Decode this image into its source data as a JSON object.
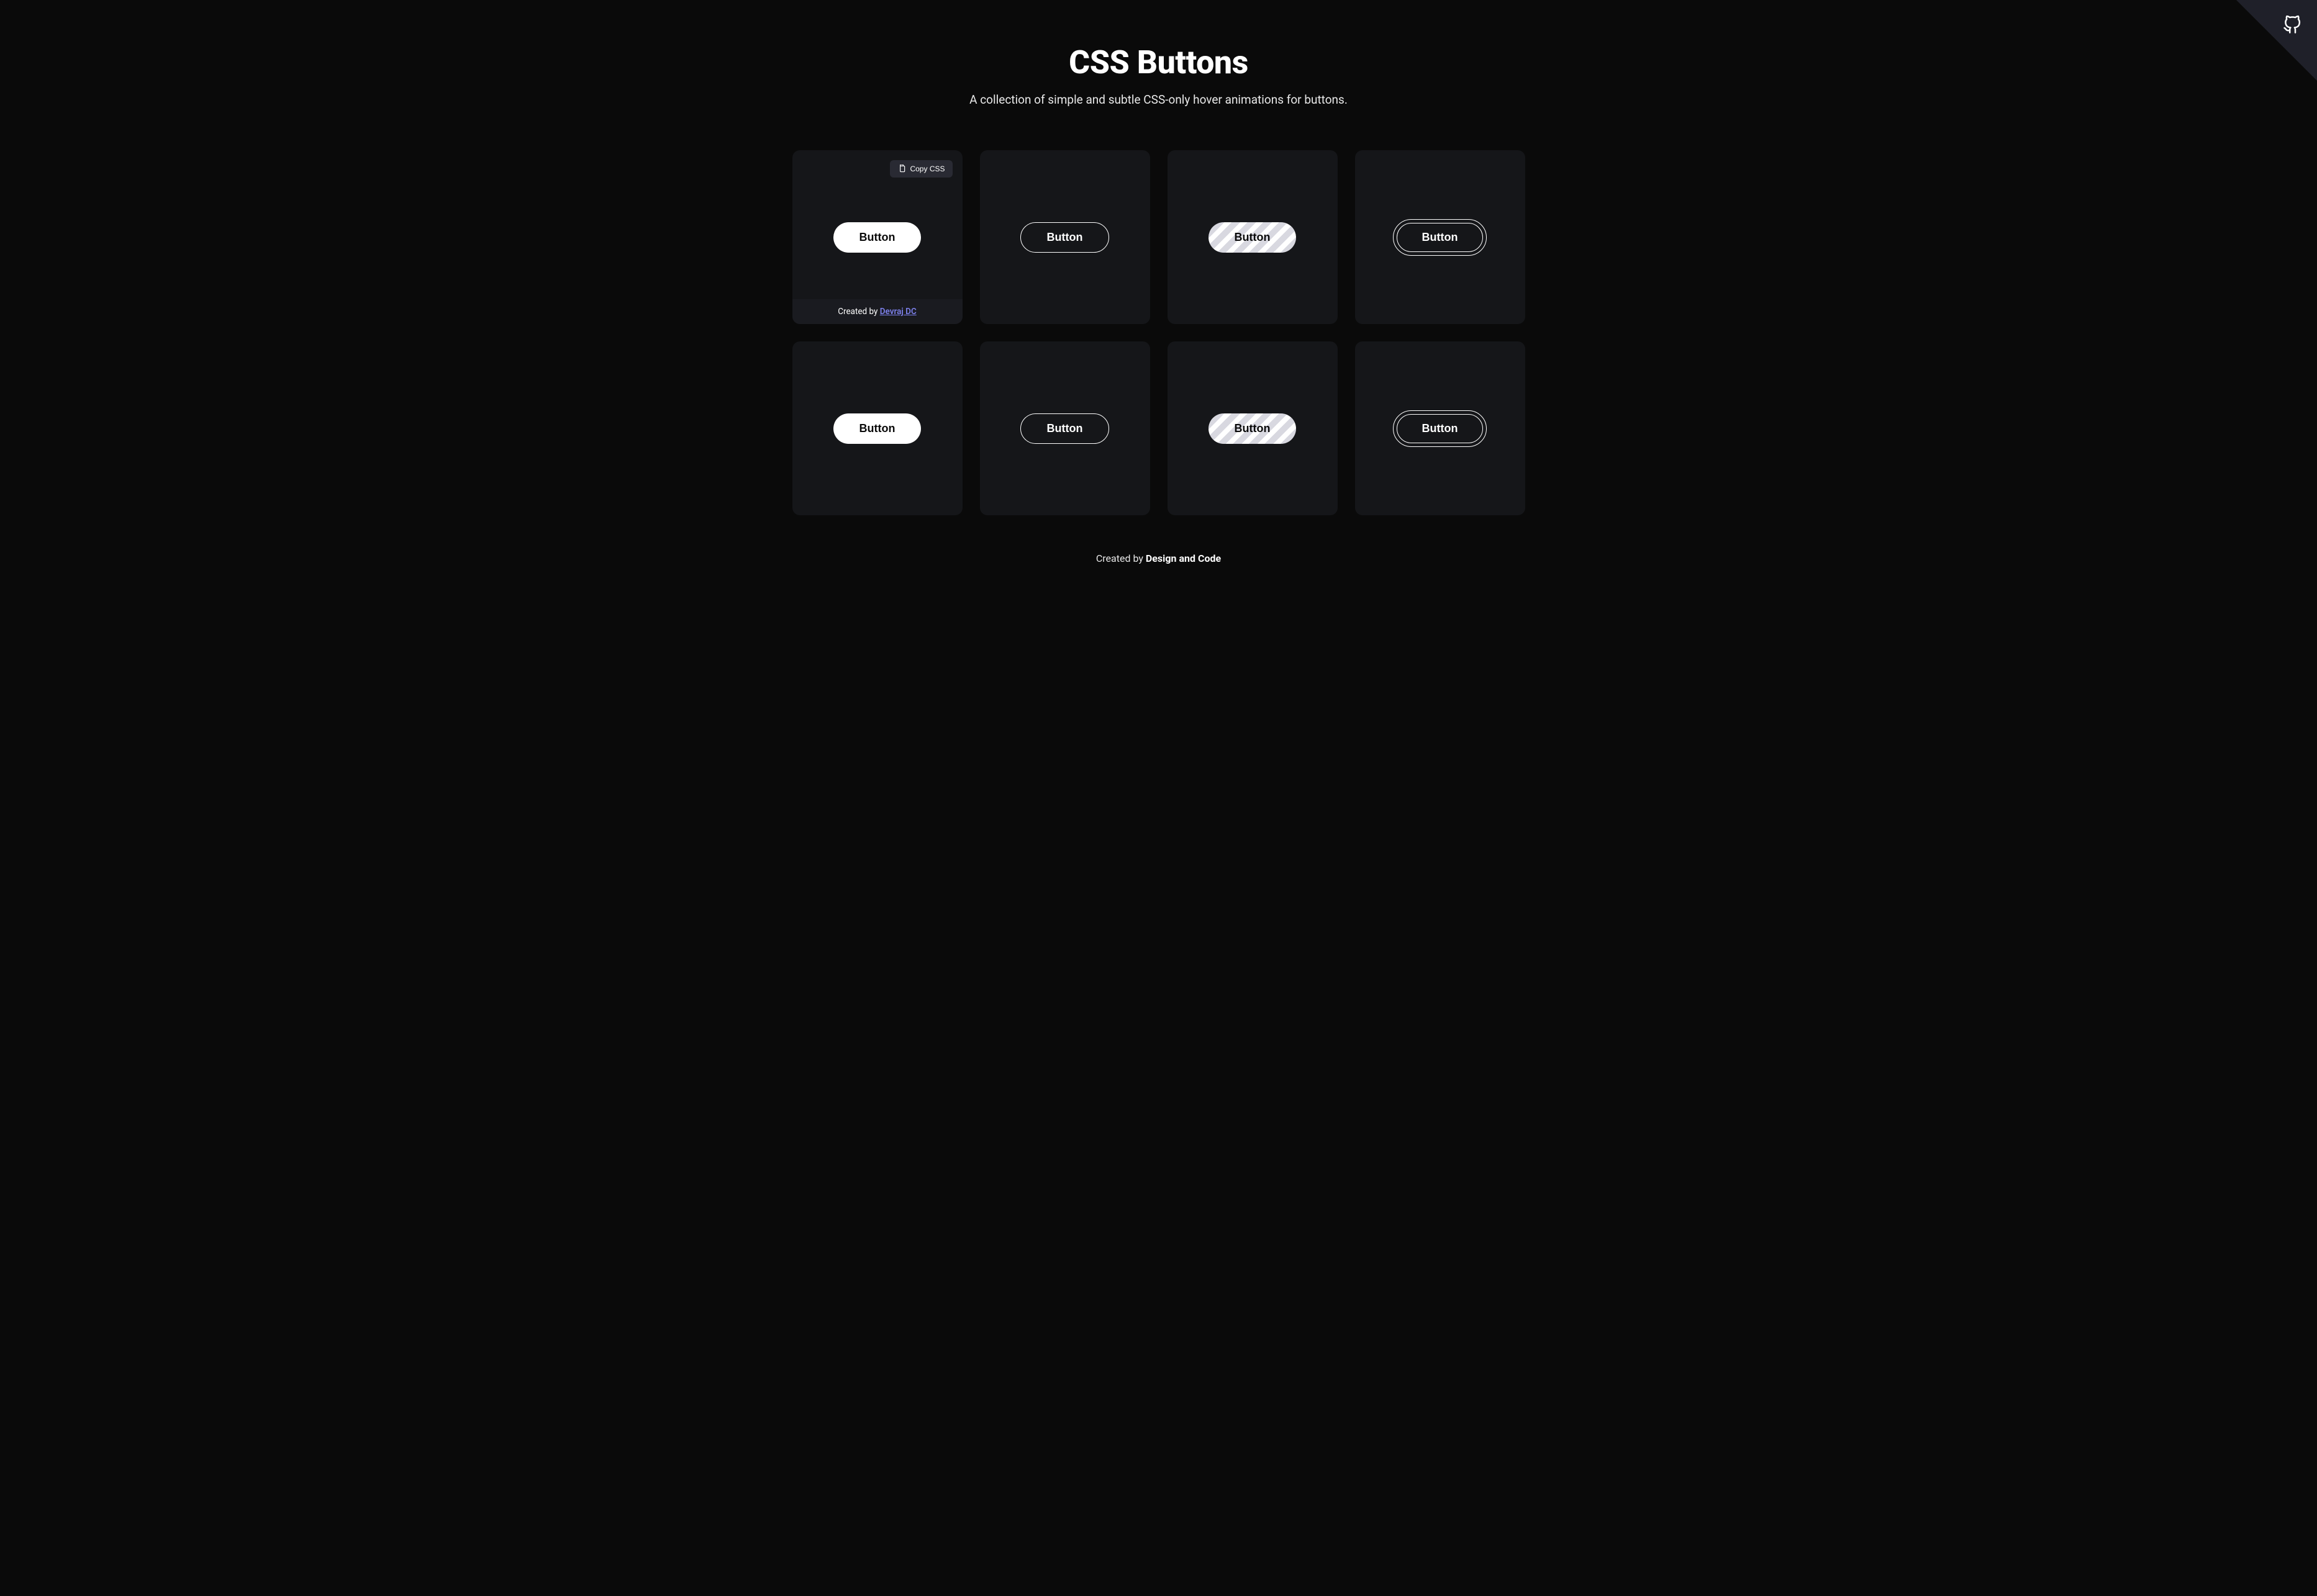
{
  "header": {
    "title": "CSS Buttons",
    "subtitle": "A collection of simple and subtle CSS-only hover animations for buttons."
  },
  "copy_button_label": "Copy CSS",
  "card_footer": {
    "prefix": "Created by ",
    "author": "Devraj DC"
  },
  "buttons": [
    {
      "label": "Button",
      "type": "filled",
      "hovered": true
    },
    {
      "label": "Button",
      "type": "outlined",
      "hovered": false
    },
    {
      "label": "Button",
      "type": "striped",
      "hovered": false
    },
    {
      "label": "Button",
      "type": "double-outline",
      "hovered": false
    },
    {
      "label": "Button",
      "type": "filled",
      "hovered": false
    },
    {
      "label": "Button",
      "type": "outlined",
      "hovered": false
    },
    {
      "label": "Button",
      "type": "striped",
      "hovered": false
    },
    {
      "label": "Button",
      "type": "double-outline",
      "hovered": false
    }
  ],
  "footer": {
    "prefix": "Created by ",
    "author": "Design and Code"
  }
}
